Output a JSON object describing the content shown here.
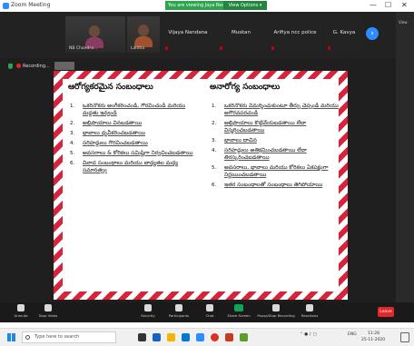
{
  "window": {
    "title": "Zoom Meeting",
    "banner_text": "You are viewing Jaya Reddy's screen",
    "view_options_label": "View Options ▾",
    "minimize_glyph": "—",
    "maximize_glyph": "☐",
    "close_glyph": "✕"
  },
  "gallery": {
    "video_tiles": [
      {
        "name": "NB Chandra..."
      },
      {
        "name": "Lalitha"
      }
    ],
    "name_tiles": [
      {
        "name": "Vijaya Nandana"
      },
      {
        "name": "Muskan"
      },
      {
        "name": "Arifiya ncc police"
      },
      {
        "name": "G. Kavya"
      }
    ],
    "next_glyph": "›",
    "side_label": "View"
  },
  "recording": {
    "label": "Recording..."
  },
  "slide": {
    "left": {
      "heading": "ఆరోగ్యకరమైన సంబంధాలు",
      "items": [
        {
          "num": "1.",
          "text": "ఒకరినొకరు అంగీకరించండి, గౌరవించండి మరియు మద్దతు ఇవ్వండి"
        },
        {
          "num": "2.",
          "text": "అభిప్రాయాలు వినబడతాయి"
        },
        {
          "num": "3.",
          "text": "భావాలు ధృవీకరించబడతాయి"
        },
        {
          "num": "4.",
          "text": "సరిహద్దులు గౌరవించబడతాయి"
        },
        {
          "num": "5.",
          "text": "అవసరాలు & కోరికలు సమిష్టిగా నిర్వచించబడతాయి"
        },
        {
          "num": "6.",
          "text": "వివాద సంబంధాలు మరియు బాధ్యతల మధ్య సమానత్వం"
        }
      ]
    },
    "right": {
      "heading": "అనారోగ్య సంబంధాలు",
      "items": [
        {
          "num": "1.",
          "text": "ఒకరినొకరు విమర్శించుకుంటూ తీర్పు చెప్పండి మరియు అగౌరవపరచండి"
        },
        {
          "num": "2.",
          "text": "అభిప్రాయాలు కొట్టివేయబడతాయి లేదా విస్మరించబడతాయి"
        },
        {
          "num": "3.",
          "text": "భావాలు దాచిన"
        },
        {
          "num": "4.",
          "text": "సరిహద్దులు అతిక్రమించబడతాయి లేదా తిరస్కరించబడతాయి"
        },
        {
          "num": "5.",
          "text": "అవసరాలు, భావాలు మరియు కోరికలు ఏకపక్షంగా నిర్ణయించబడతాయి"
        },
        {
          "num": "6.",
          "text": "ఇతర సంబంధాలతో సంబంధాలు తెగిపోయాయి"
        }
      ]
    }
  },
  "toolbar": {
    "buttons": [
      {
        "label": "Unmute"
      },
      {
        "label": "Stop Video"
      },
      {
        "label": "Security"
      },
      {
        "label": "Participants"
      },
      {
        "label": "Chat"
      },
      {
        "label": "Share Screen"
      },
      {
        "label": "Pause/Stop Recording"
      },
      {
        "label": "Reactions"
      }
    ],
    "end_label": "Leave"
  },
  "taskbar": {
    "search_placeholder": "Type here to search",
    "tray_text": "ENG",
    "time": "11:28",
    "date": "25-11-2020"
  },
  "colors": {
    "accent_blue": "#2d8cff",
    "banner_green": "#2da44e",
    "stripe_red": "#d8233a",
    "leave_red": "#e02828"
  }
}
